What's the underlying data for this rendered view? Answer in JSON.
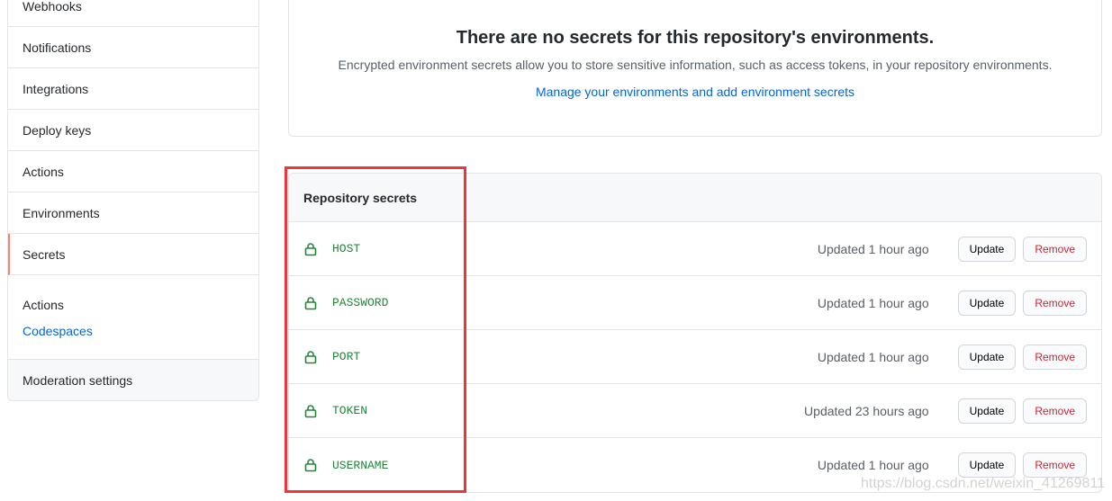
{
  "sidebar": {
    "items": [
      {
        "label": "Webhooks"
      },
      {
        "label": "Notifications"
      },
      {
        "label": "Integrations"
      },
      {
        "label": "Deploy keys"
      },
      {
        "label": "Actions"
      },
      {
        "label": "Environments"
      },
      {
        "label": "Secrets",
        "selected": true
      }
    ],
    "group": [
      {
        "label": "Actions"
      },
      {
        "label": "Codespaces"
      }
    ],
    "last": {
      "label": "Moderation settings"
    }
  },
  "environments": {
    "title": "There are no secrets for this repository's environments.",
    "description": "Encrypted environment secrets allow you to store sensitive information, such as access tokens, in your repository environments.",
    "link": "Manage your environments and add environment secrets"
  },
  "secrets": {
    "header": "Repository secrets",
    "update_label": "Update",
    "remove_label": "Remove",
    "rows": [
      {
        "name": "HOST",
        "updated": "Updated 1 hour ago"
      },
      {
        "name": "PASSWORD",
        "updated": "Updated 1 hour ago"
      },
      {
        "name": "PORT",
        "updated": "Updated 1 hour ago"
      },
      {
        "name": "TOKEN",
        "updated": "Updated 23 hours ago"
      },
      {
        "name": "USERNAME",
        "updated": "Updated 1 hour ago"
      }
    ]
  },
  "watermark": "https://blog.csdn.net/weixin_41269811",
  "colors": {
    "accent": "#0366d6",
    "secret_name": "#22863a",
    "danger": "#cb2431",
    "highlight_box": "#f0343c",
    "selected_indicator": "#f9826c"
  }
}
